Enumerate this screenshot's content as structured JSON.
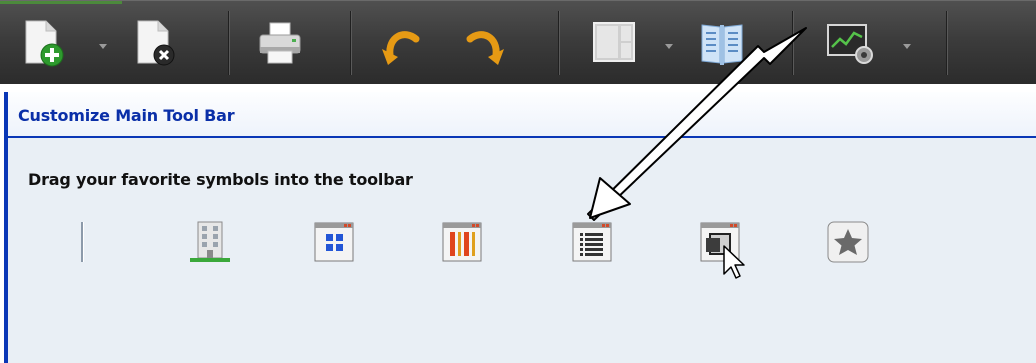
{
  "toolbar": {
    "buttons": [
      {
        "name": "new-document-button",
        "icon": "new-document-icon"
      },
      {
        "name": "close-document-button",
        "icon": "close-document-icon"
      },
      {
        "name": "print-button",
        "icon": "printer-icon"
      },
      {
        "name": "undo-button",
        "icon": "undo-icon"
      },
      {
        "name": "redo-button",
        "icon": "redo-icon"
      },
      {
        "name": "layout-button",
        "icon": "layout-panels-icon"
      },
      {
        "name": "book-view-button",
        "icon": "open-book-icon"
      },
      {
        "name": "chart-settings-button",
        "icon": "chart-settings-icon"
      }
    ]
  },
  "dialog": {
    "title": "Customize Main Tool Bar",
    "instruction": "Drag your favorite symbols into the toolbar",
    "symbols": [
      {
        "name": "separator-symbol",
        "icon": "separator-icon"
      },
      {
        "name": "building-symbol",
        "icon": "building-icon"
      },
      {
        "name": "grid-window-symbol",
        "icon": "grid-window-icon"
      },
      {
        "name": "columns-window-symbol",
        "icon": "columns-window-icon"
      },
      {
        "name": "list-window-symbol",
        "icon": "list-window-icon"
      },
      {
        "name": "restore-window-symbol",
        "icon": "restore-window-icon"
      },
      {
        "name": "favorite-star-symbol",
        "icon": "star-icon"
      }
    ]
  },
  "colors": {
    "toolbar_bg": "#3c3c3c",
    "dialog_border": "#0a37b6",
    "dialog_title": "#0a2fa8",
    "dialog_body": "#e9eff5"
  }
}
